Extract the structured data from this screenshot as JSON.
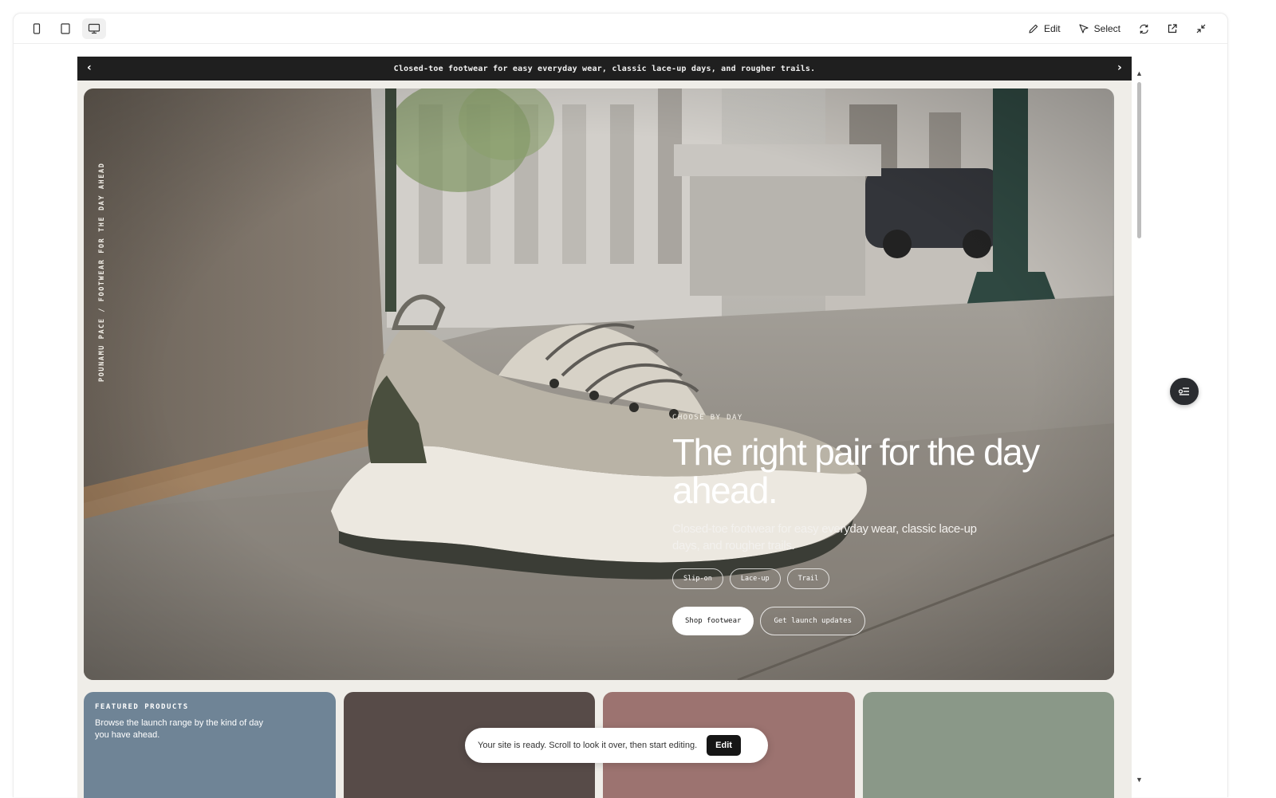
{
  "toolbar": {
    "devices": [
      {
        "name": "mobile",
        "icon": "phone-icon"
      },
      {
        "name": "tablet",
        "icon": "tablet-icon"
      },
      {
        "name": "desktop",
        "icon": "monitor-icon",
        "active": true
      }
    ],
    "edit_label": "Edit",
    "select_label": "Select",
    "icons": [
      "pencil-icon",
      "cursor-icon",
      "refresh-icon",
      "external-link-icon",
      "collapse-icon"
    ]
  },
  "site": {
    "announcement": "Closed-toe footwear for easy everyday wear, classic lace-up days, and rougher trails.",
    "hero": {
      "vertical_label": "POUNAMU PACE / FOOTWEAR FOR THE DAY AHEAD",
      "eyebrow": "CHOOSE BY DAY",
      "headline": "The right pair for the day ahead.",
      "subtext": "Closed-toe footwear for easy everyday wear, classic lace-up days, and rougher trails.",
      "tags": [
        "Slip-on",
        "Lace-up",
        "Trail"
      ],
      "primary_cta": "Shop footwear",
      "secondary_cta": "Get launch updates"
    },
    "featured": {
      "eyebrow": "FEATURED PRODUCTS",
      "text": "Browse the launch range by the kind of day you have ahead."
    }
  },
  "toast": {
    "message": "Your site is ready. Scroll to look it over, then start editing.",
    "button": "Edit"
  },
  "colors": {
    "accent_dark": "#161616",
    "card_blue": "#6f8496",
    "card_brown": "#574b48",
    "card_rose": "#9c7370",
    "card_sage": "#8a9888"
  }
}
